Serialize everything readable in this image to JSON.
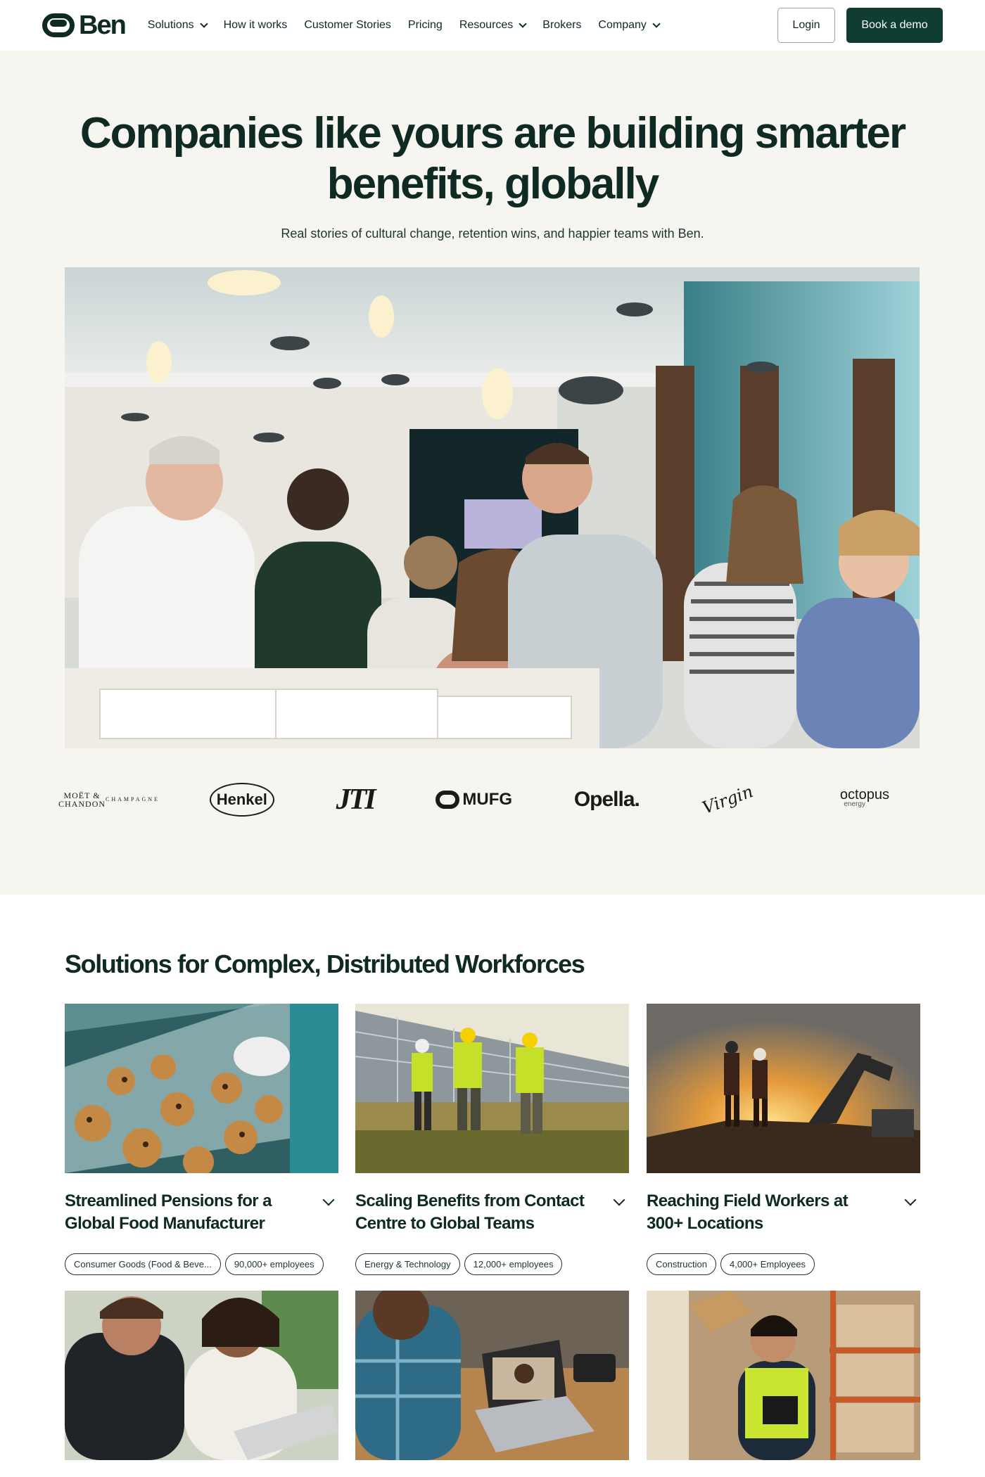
{
  "nav": {
    "logo_text": "Ben",
    "items": [
      {
        "label": "Solutions",
        "has_dropdown": true
      },
      {
        "label": "How it works",
        "has_dropdown": false
      },
      {
        "label": "Customer Stories",
        "has_dropdown": false
      },
      {
        "label": "Pricing",
        "has_dropdown": false
      },
      {
        "label": "Resources",
        "has_dropdown": true
      },
      {
        "label": "Brokers",
        "has_dropdown": false
      },
      {
        "label": "Company",
        "has_dropdown": true
      }
    ],
    "login_label": "Login",
    "demo_label": "Book a demo"
  },
  "hero": {
    "title": "Companies like yours are building smarter benefits, globally",
    "subtitle": "Real stories of cultural change, retention wins, and happier teams with Ben."
  },
  "client_logos": {
    "moet": "MOËT & CHANDON",
    "moet_sub": "CHAMPAGNE",
    "henkel": "Henkel",
    "jti": "JTI",
    "mufg": "MUFG",
    "opella": "Opella.",
    "virgin": "Virgin",
    "octopus": "octopus",
    "octopus_sub": "energy"
  },
  "solutions": {
    "title": "Solutions for Complex, Distributed Workforces",
    "cards": [
      {
        "title": "Streamlined Pensions for a Global Food Manufacturer",
        "tags": [
          "Consumer Goods (Food & Beve...",
          "90,000+ employees"
        ]
      },
      {
        "title": "Scaling Benefits from Contact Centre to Global Teams",
        "tags": [
          "Energy & Technology",
          "12,000+ employees"
        ]
      },
      {
        "title": "Reaching Field Workers at 300+ Locations",
        "tags": [
          "Construction",
          "4,000+ Employees"
        ]
      }
    ]
  },
  "colors": {
    "brand_dark": "#0f3d33",
    "text": "#0f2a22",
    "hero_bg": "#f6f5ef"
  }
}
